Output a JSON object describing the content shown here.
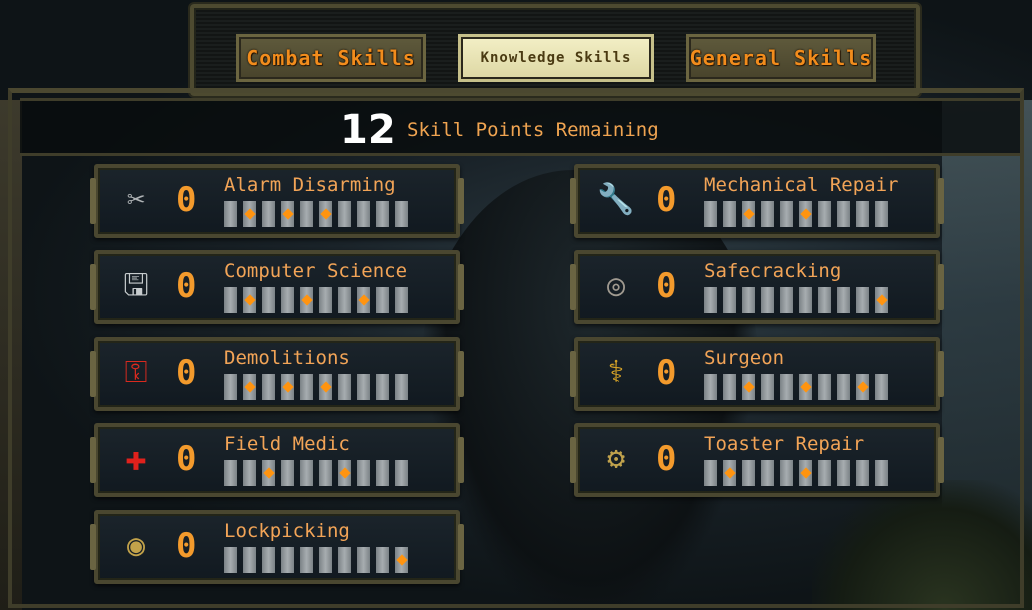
{
  "tabs": [
    {
      "label": "Combat Skills",
      "active": false
    },
    {
      "label": "Knowledge Skills",
      "active": true
    },
    {
      "label": "General Skills",
      "active": false
    }
  ],
  "skill_points": {
    "value": "12",
    "label": "Skill Points Remaining"
  },
  "colors": {
    "accent_orange": "#f39a2c",
    "active_tab": "#e8e3b4",
    "frame": "#4a4730"
  },
  "skills": [
    {
      "name": "Alarm Disarming",
      "value": "0",
      "icon": "pliers-icon",
      "marks": [
        2,
        4,
        6
      ]
    },
    {
      "name": "Computer Science",
      "value": "0",
      "icon": "floppy-disk-icon",
      "marks": [
        2,
        5,
        8
      ]
    },
    {
      "name": "Demolitions",
      "value": "0",
      "icon": "dynamite-icon",
      "marks": [
        2,
        4,
        6
      ]
    },
    {
      "name": "Field Medic",
      "value": "0",
      "icon": "red-cross-icon",
      "marks": [
        3,
        7
      ]
    },
    {
      "name": "Lockpicking",
      "value": "0",
      "icon": "lock-cylinder-icon",
      "marks": [
        10
      ]
    },
    {
      "name": "Mechanical Repair",
      "value": "0",
      "icon": "wrench-robot-icon",
      "marks": [
        3,
        6
      ]
    },
    {
      "name": "Safecracking",
      "value": "0",
      "icon": "safe-dial-icon",
      "marks": [
        10
      ]
    },
    {
      "name": "Surgeon",
      "value": "0",
      "icon": "caduceus-icon",
      "marks": [
        3,
        6,
        9
      ]
    },
    {
      "name": "Toaster Repair",
      "value": "0",
      "icon": "toaster-icon",
      "marks": [
        2,
        6
      ]
    }
  ],
  "bar_count": 10
}
